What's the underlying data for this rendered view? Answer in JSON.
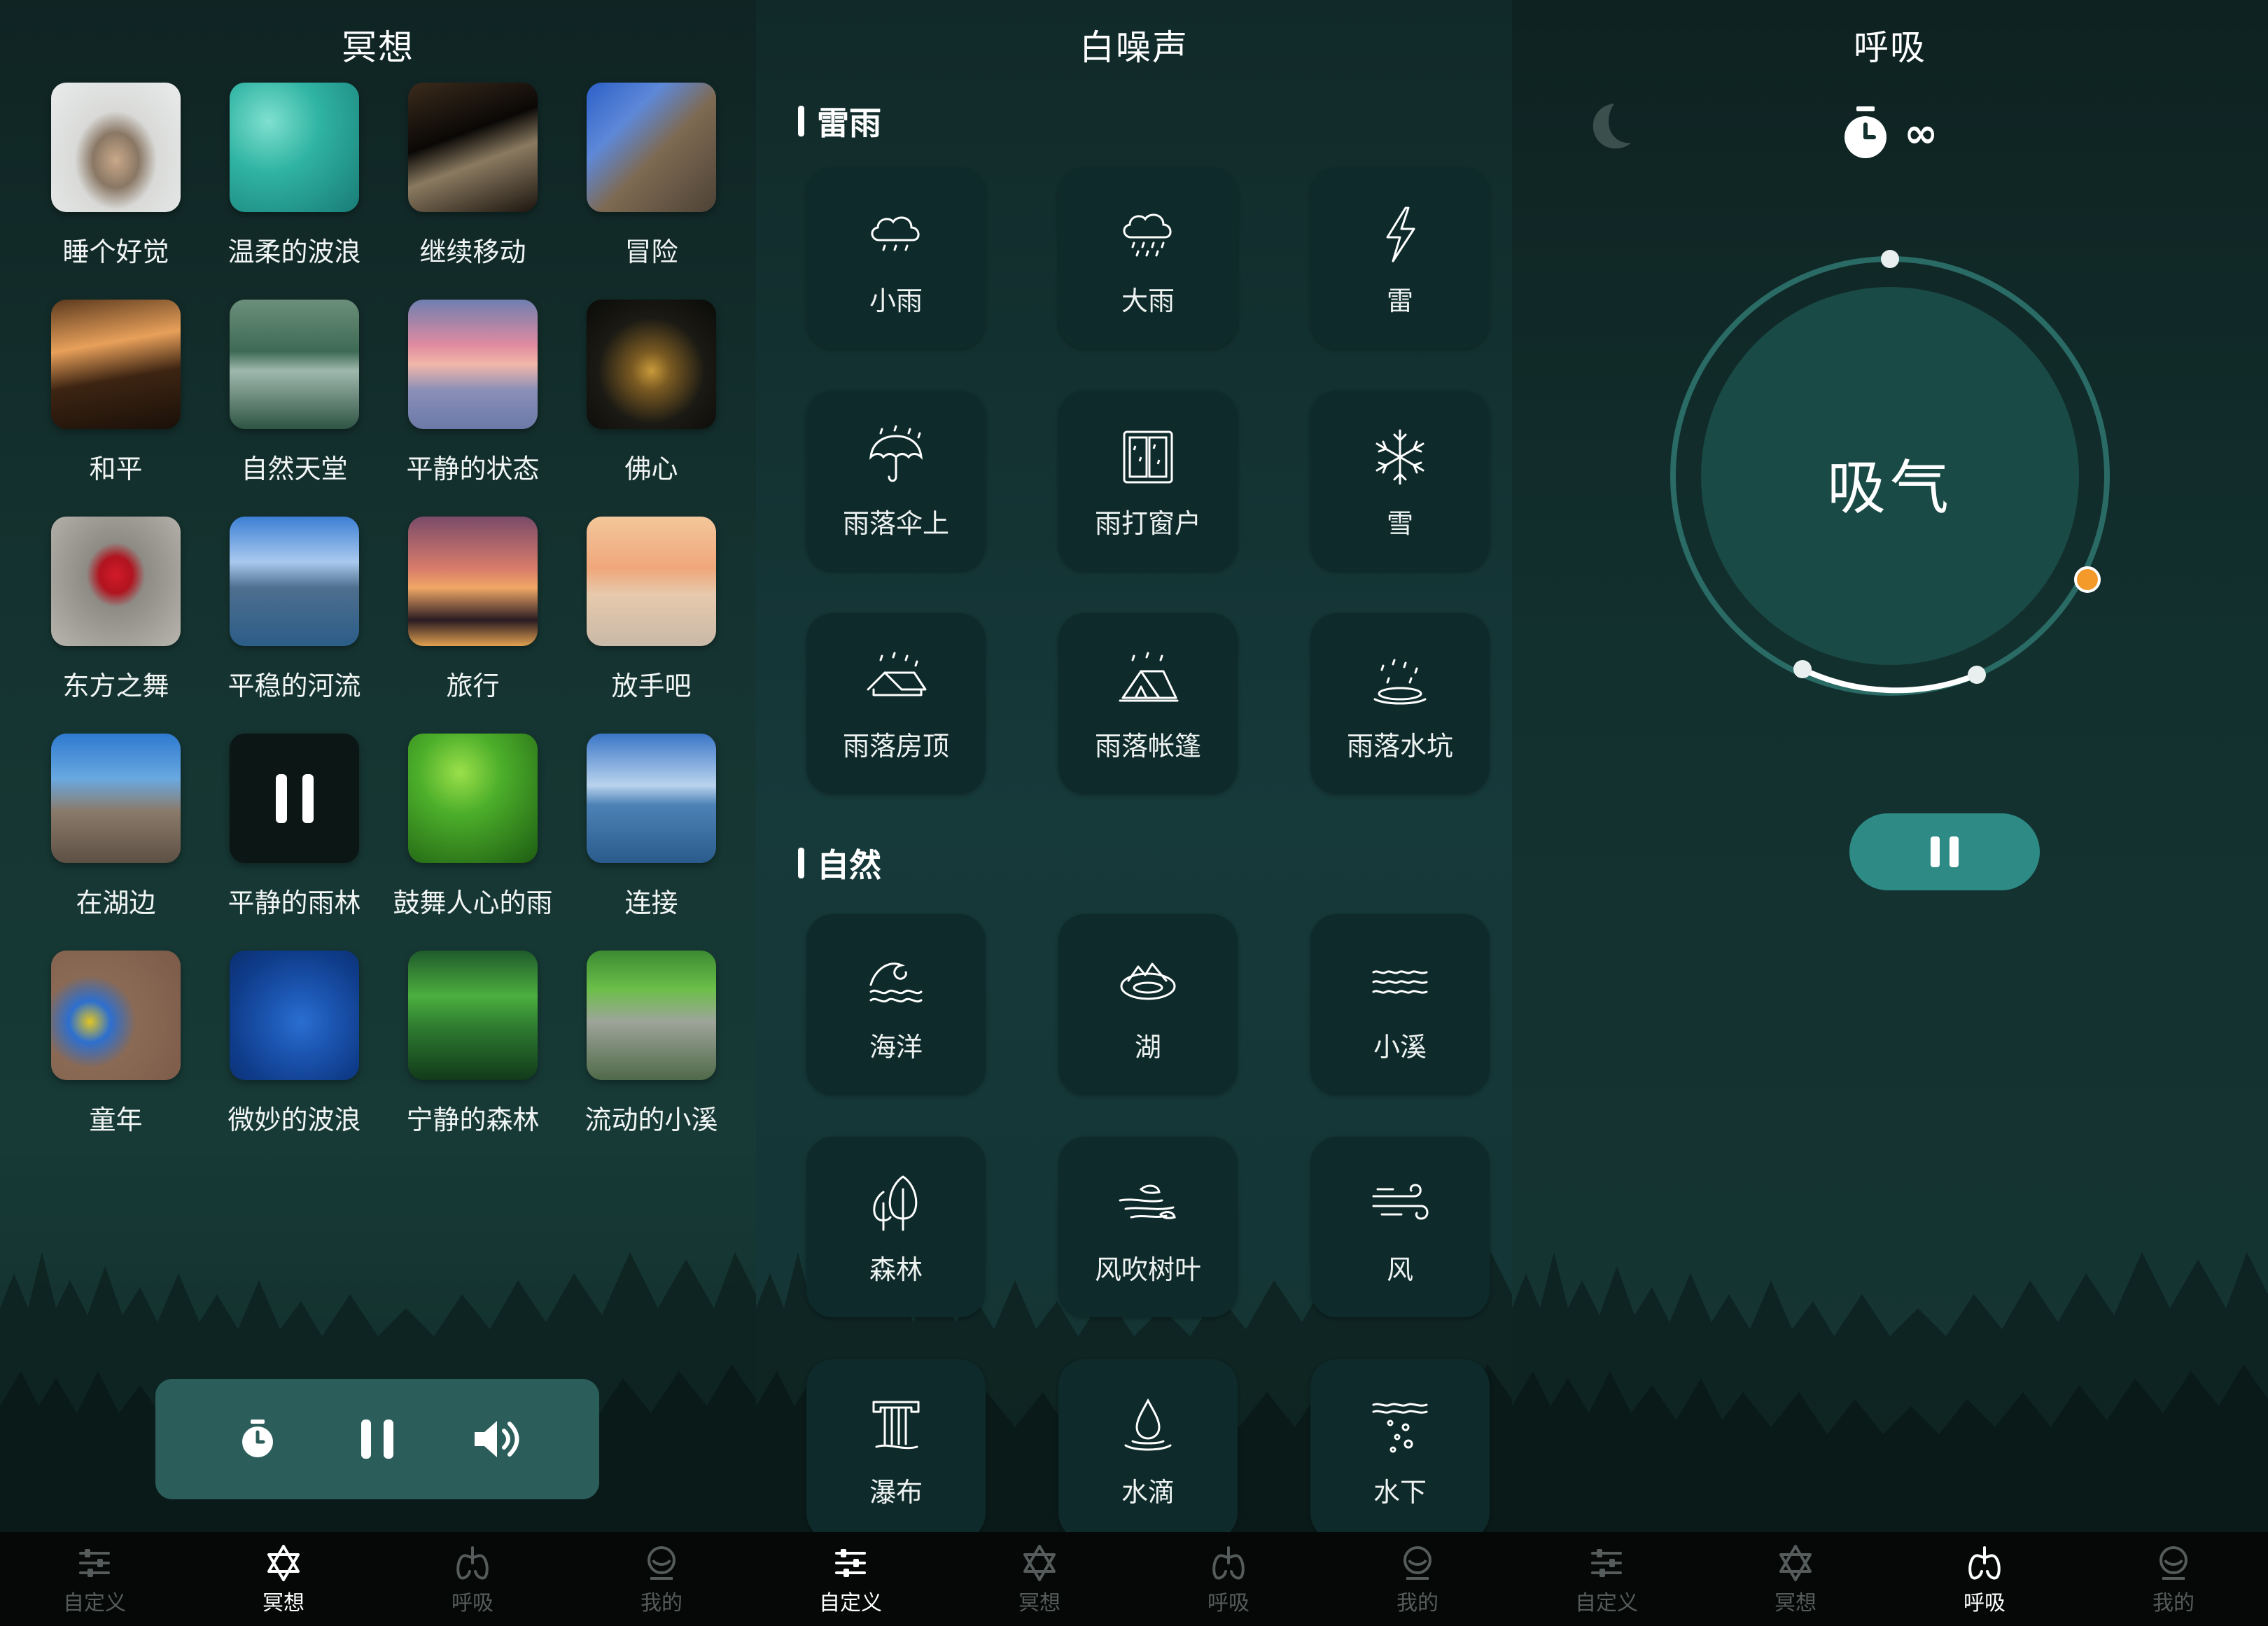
{
  "meditation": {
    "title": "冥想",
    "items": [
      {
        "label": "睡个好觉"
      },
      {
        "label": "温柔的波浪"
      },
      {
        "label": "继续移动"
      },
      {
        "label": "冒险"
      },
      {
        "label": "和平"
      },
      {
        "label": "自然天堂"
      },
      {
        "label": "平静的状态"
      },
      {
        "label": "佛心"
      },
      {
        "label": "东方之舞"
      },
      {
        "label": "平稳的河流"
      },
      {
        "label": "旅行"
      },
      {
        "label": "放手吧"
      },
      {
        "label": "在湖边"
      },
      {
        "label": "平静的雨林"
      },
      {
        "label": "鼓舞人心的雨"
      },
      {
        "label": "连接"
      },
      {
        "label": "童年"
      },
      {
        "label": "微妙的波浪"
      },
      {
        "label": "宁静的森林"
      },
      {
        "label": "流动的小溪"
      }
    ],
    "playing_index": 13
  },
  "white_noise": {
    "title": "白噪声",
    "sections": [
      {
        "title": "雷雨",
        "items": [
          {
            "label": "小雨",
            "icon": "cloud-light-rain-icon"
          },
          {
            "label": "大雨",
            "icon": "cloud-heavy-rain-icon"
          },
          {
            "label": "雷",
            "icon": "lightning-icon"
          },
          {
            "label": "雨落伞上",
            "icon": "umbrella-rain-icon"
          },
          {
            "label": "雨打窗户",
            "icon": "window-rain-icon"
          },
          {
            "label": "雪",
            "icon": "snowflake-icon"
          },
          {
            "label": "雨落房顶",
            "icon": "roof-rain-icon"
          },
          {
            "label": "雨落帐篷",
            "icon": "tent-rain-icon"
          },
          {
            "label": "雨落水坑",
            "icon": "puddle-rain-icon"
          }
        ]
      },
      {
        "title": "自然",
        "items": [
          {
            "label": "海洋",
            "icon": "ocean-wave-icon"
          },
          {
            "label": "湖",
            "icon": "lake-icon"
          },
          {
            "label": "小溪",
            "icon": "stream-icon"
          },
          {
            "label": "森林",
            "icon": "forest-icon"
          },
          {
            "label": "风吹树叶",
            "icon": "wind-leaves-icon"
          },
          {
            "label": "风",
            "icon": "wind-icon"
          },
          {
            "label": "瀑布",
            "icon": "waterfall-icon"
          },
          {
            "label": "水滴",
            "icon": "water-drop-icon"
          },
          {
            "label": "水下",
            "icon": "underwater-icon"
          }
        ]
      }
    ]
  },
  "breathing": {
    "title": "呼吸",
    "phase": "吸气",
    "duration_symbol": "∞",
    "accent": "#2d8a85",
    "marker_color": "#f39a2b"
  },
  "tabbars": [
    {
      "active": 1,
      "tabs": [
        "自定义",
        "冥想",
        "呼吸",
        "我的"
      ]
    },
    {
      "active": 0,
      "tabs": [
        "自定义",
        "冥想",
        "呼吸",
        "我的"
      ]
    },
    {
      "active": 2,
      "tabs": [
        "自定义",
        "冥想",
        "呼吸",
        "我的"
      ]
    }
  ]
}
